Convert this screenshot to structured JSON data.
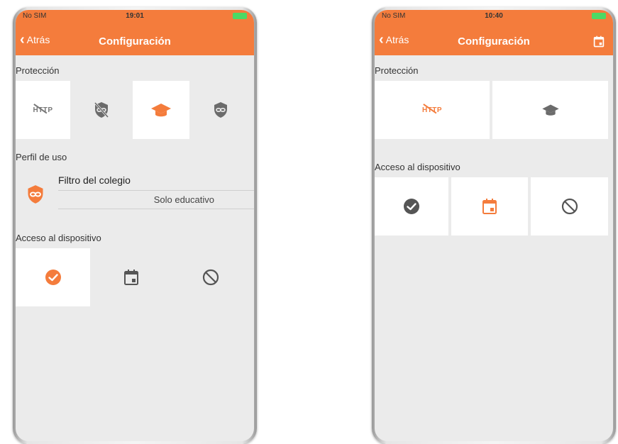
{
  "colors": {
    "accent": "#f47c3c",
    "background": "#ebebeb",
    "tile": "#ffffff",
    "icon_grey": "#6b6b6b"
  },
  "left": {
    "status": {
      "carrier": "No SIM",
      "time": "19:01"
    },
    "nav": {
      "back_label": "Atrás",
      "title": "Configuración"
    },
    "protection": {
      "label": "Protección",
      "options": [
        {
          "icon": "http-blocked-icon",
          "selected": false
        },
        {
          "icon": "shield-blocked-icon",
          "selected": false
        },
        {
          "icon": "graduation-cap-icon",
          "selected": true
        },
        {
          "icon": "shield-infinity-icon",
          "selected": false
        }
      ]
    },
    "profile": {
      "label": "Perfil de uso",
      "name": "Filtro del colegio",
      "mode": "Solo educativo",
      "icon": "shield-infinity-icon"
    },
    "access": {
      "label": "Acceso al dispositivo",
      "options": [
        {
          "icon": "check-circle-icon",
          "selected": true
        },
        {
          "icon": "calendar-icon",
          "selected": false
        },
        {
          "icon": "block-icon",
          "selected": false
        }
      ]
    }
  },
  "right": {
    "status": {
      "carrier": "No SIM",
      "time": "10:40"
    },
    "nav": {
      "back_label": "Atrás",
      "title": "Configuración",
      "right_icon": "calendar-icon"
    },
    "protection": {
      "label": "Protección",
      "options": [
        {
          "icon": "http-blocked-icon",
          "selected": true
        },
        {
          "icon": "graduation-cap-icon",
          "selected": false
        }
      ]
    },
    "access": {
      "label": "Acceso al dispositivo",
      "options": [
        {
          "icon": "check-circle-icon",
          "selected": false
        },
        {
          "icon": "calendar-icon",
          "selected": true
        },
        {
          "icon": "block-icon",
          "selected": false
        }
      ]
    }
  }
}
